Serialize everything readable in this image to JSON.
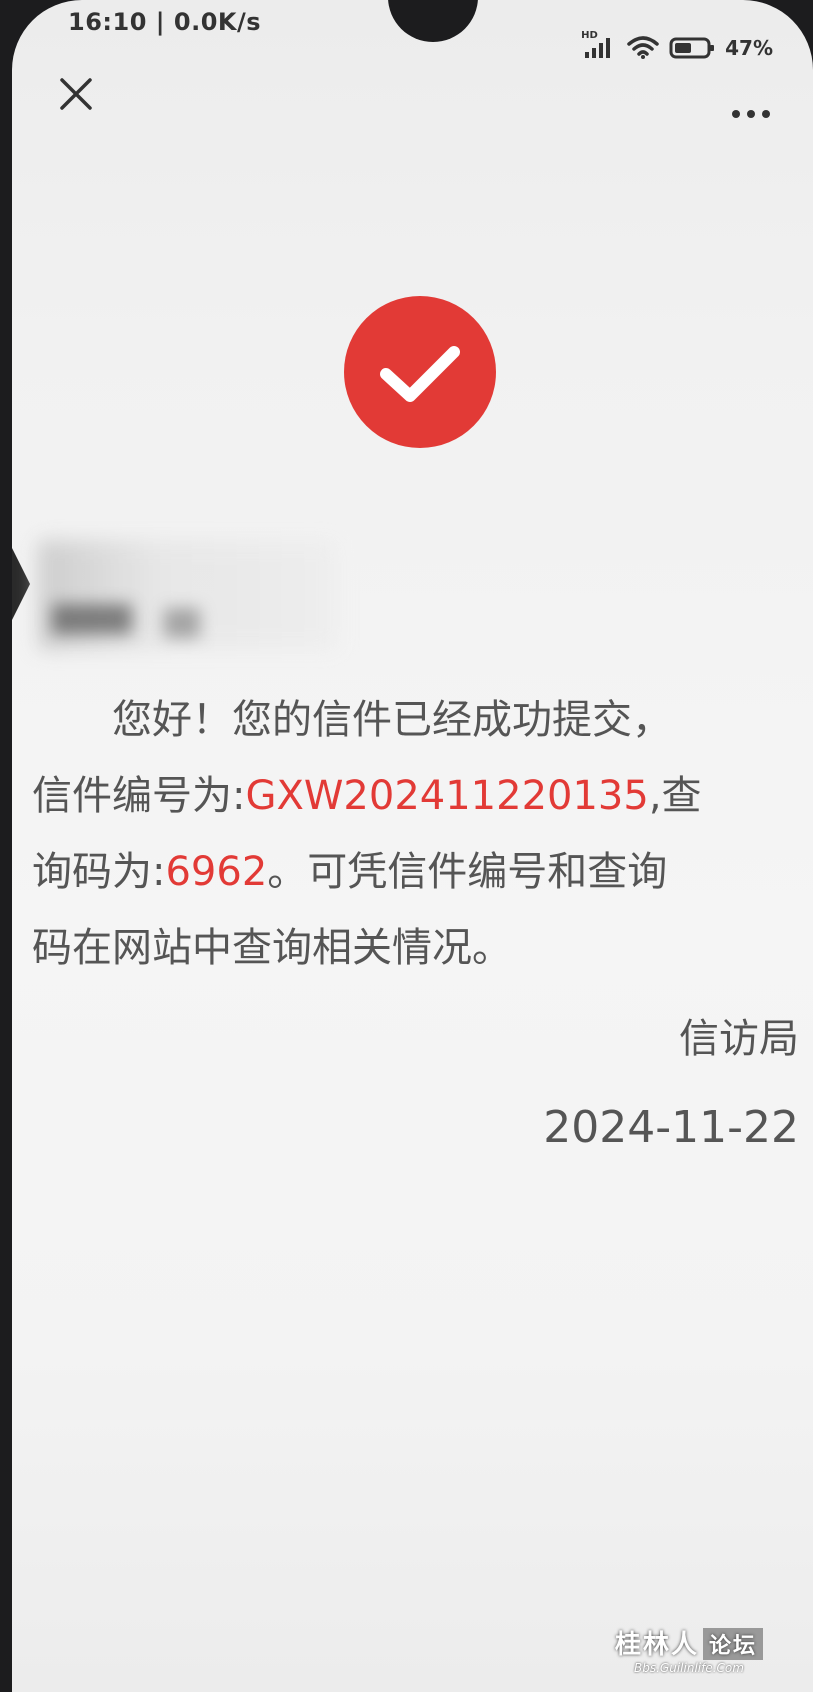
{
  "status_bar": {
    "time_speed": "16:10 | 0.0K/s",
    "network_badge": "HD",
    "battery_percent": "47%"
  },
  "toolbar": {
    "close_icon": "close-icon",
    "more_icon": "more-icon"
  },
  "success": {
    "icon": "checkmark-icon",
    "color": "#e23a36"
  },
  "message": {
    "line1": "您好！您的信件已经成功提交，",
    "line2_prefix": "信件编号为:",
    "letter_number": "GXW202411220135",
    "line2_suffix": ",查",
    "line3_prefix": "询码为:",
    "query_code": "6962",
    "line3_suffix": "。可凭信件编号和查询",
    "line4": "码在网站中查询相关情况。"
  },
  "sender": "信访局",
  "date": "2024-11-22",
  "watermark": {
    "main": "桂林人",
    "box": "论坛",
    "sub": "Bbs.Guilinlife.Com"
  }
}
